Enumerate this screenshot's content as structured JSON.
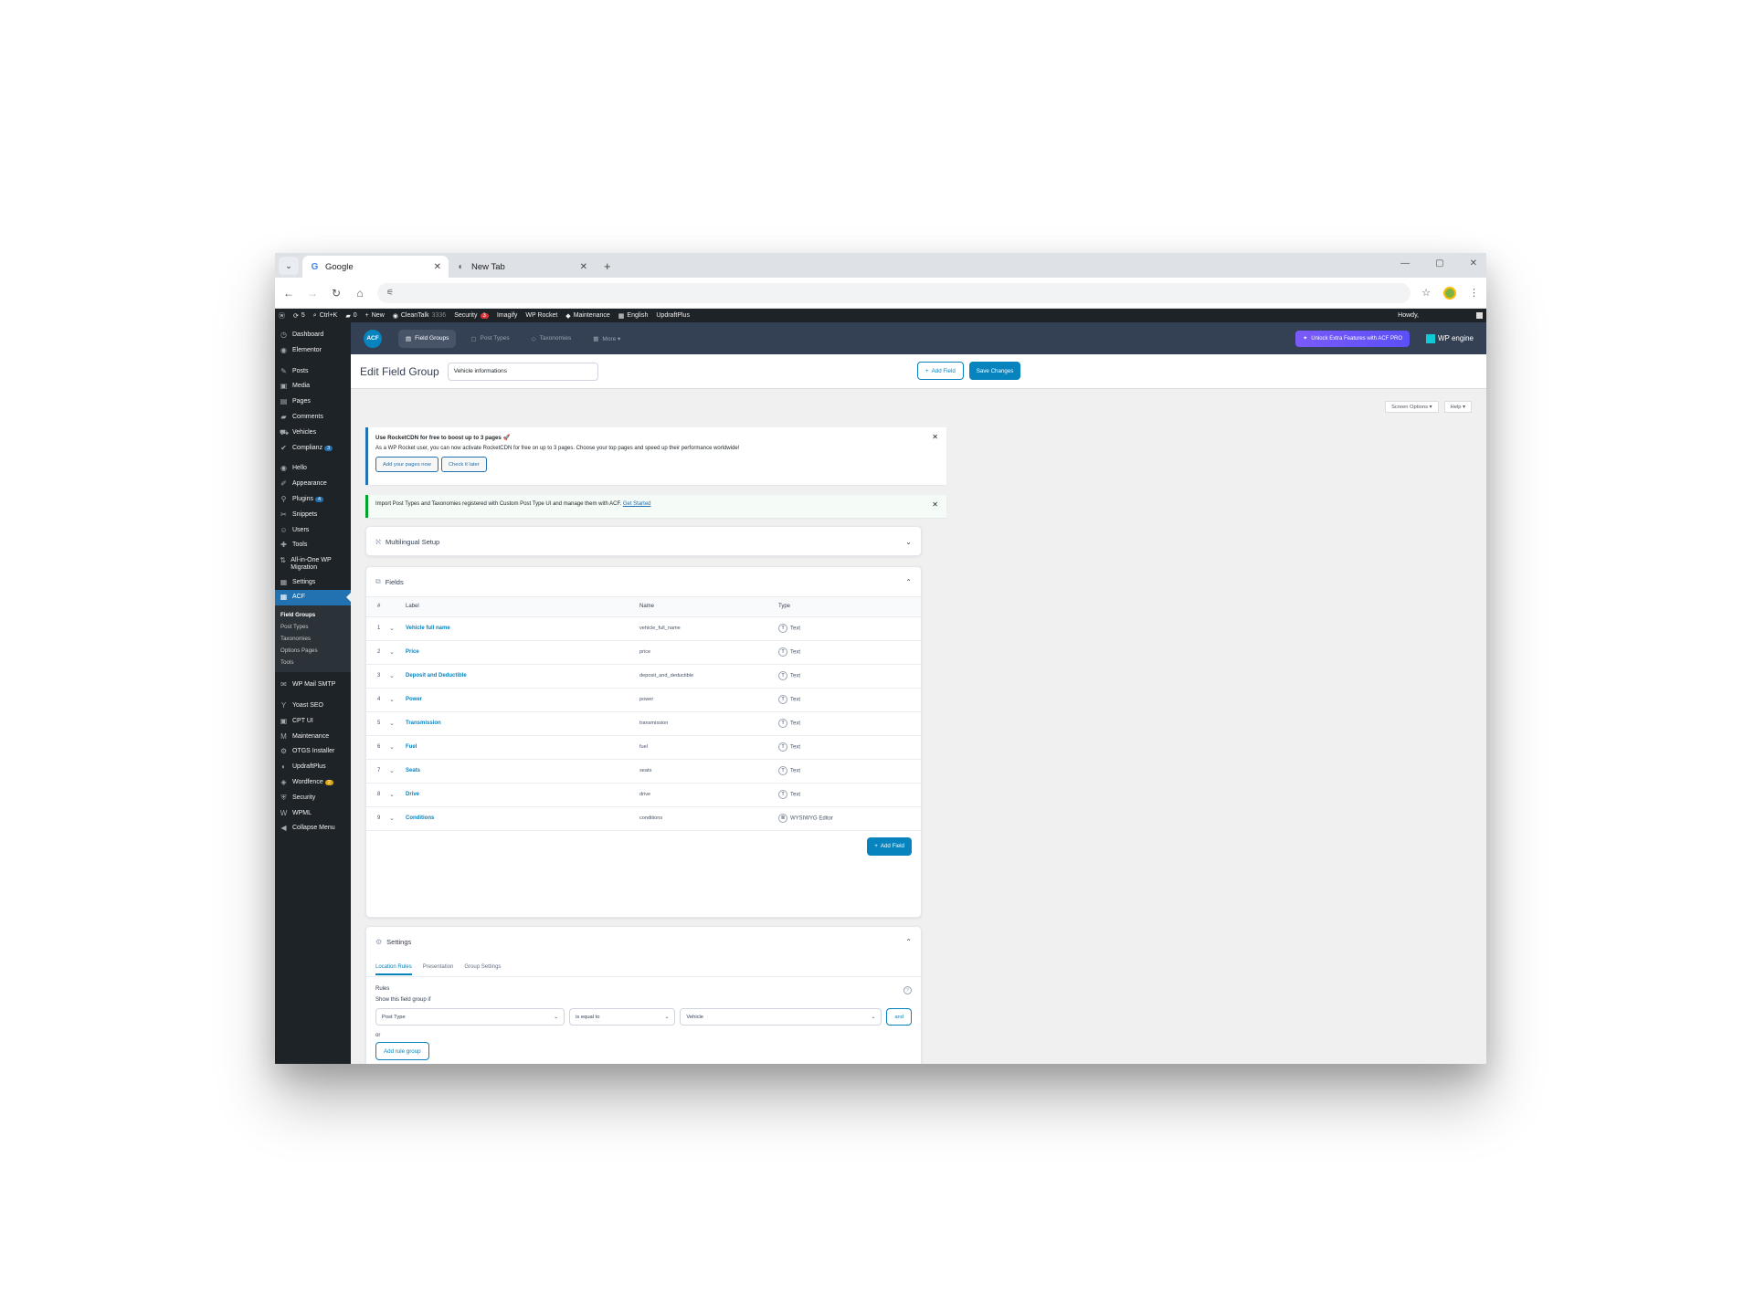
{
  "browser": {
    "tabs": [
      {
        "title": "Google",
        "favicon": "G",
        "active": true
      },
      {
        "title": "New Tab",
        "favicon": "◐",
        "active": false
      }
    ],
    "new_tab": "+",
    "window_controls": [
      "—",
      "▢",
      "✕"
    ]
  },
  "adminbar": {
    "items": [
      {
        "icon": "wp-logo-icon",
        "glyph": "ⓦ",
        "text": ""
      },
      {
        "icon": "updates-icon",
        "glyph": "⟳",
        "text": "5"
      },
      {
        "icon": "search-icon",
        "glyph": "⌕",
        "text": "Ctrl+K"
      },
      {
        "icon": "comments-icon",
        "glyph": "▰",
        "text": "0"
      },
      {
        "icon": "plus-icon",
        "glyph": "+",
        "text": "New"
      },
      {
        "icon": "cleantalk-icon",
        "glyph": "◉",
        "text": "CleanTalk"
      },
      {
        "icon": "security-icon",
        "glyph": "",
        "text": "Security",
        "badge": "3"
      },
      {
        "icon": "imagify-icon",
        "glyph": "",
        "text": "Imagify"
      },
      {
        "icon": "rocket-icon",
        "glyph": "",
        "text": "WP Rocket"
      },
      {
        "icon": "maintenance-icon",
        "glyph": "◆",
        "text": "Maintenance"
      },
      {
        "icon": "flag-icon",
        "glyph": "▦",
        "text": "English"
      },
      {
        "icon": "updraft-icon",
        "glyph": "",
        "text": "UpdraftPlus"
      }
    ],
    "cleantalk_count": "3336",
    "howdy": "Howdy,"
  },
  "sidebar": {
    "items": [
      {
        "icon": "dashboard-icon",
        "glyph": "◷",
        "label": "Dashboard"
      },
      {
        "icon": "elementor-icon",
        "glyph": "◉",
        "label": "Elementor"
      },
      {
        "sep": true
      },
      {
        "icon": "posts-icon",
        "glyph": "✎",
        "label": "Posts"
      },
      {
        "icon": "media-icon",
        "glyph": "▣",
        "label": "Media"
      },
      {
        "icon": "pages-icon",
        "glyph": "▤",
        "label": "Pages"
      },
      {
        "icon": "comments-icon",
        "glyph": "▰",
        "label": "Comments"
      },
      {
        "icon": "vehicles-icon",
        "glyph": "⛟",
        "label": "Vehicles"
      },
      {
        "icon": "complianz-icon",
        "glyph": "✔",
        "label": "Complianz",
        "badge": "3"
      },
      {
        "sep": true
      },
      {
        "icon": "hello-icon",
        "glyph": "◉",
        "label": "Hello"
      },
      {
        "icon": "appearance-icon",
        "glyph": "✐",
        "label": "Appearance"
      },
      {
        "icon": "plugins-icon",
        "glyph": "⚲",
        "label": "Plugins",
        "badge": "4"
      },
      {
        "icon": "snippets-icon",
        "glyph": "✂",
        "label": "Snippets"
      },
      {
        "icon": "users-icon",
        "glyph": "☺",
        "label": "Users"
      },
      {
        "icon": "tools-icon",
        "glyph": "✚",
        "label": "Tools"
      },
      {
        "icon": "migration-icon",
        "glyph": "⇅",
        "label": "All-in-One WP Migration"
      },
      {
        "icon": "settings-icon",
        "glyph": "▦",
        "label": "Settings"
      },
      {
        "icon": "acf-icon",
        "glyph": "▦",
        "label": "ACF",
        "current": true
      }
    ],
    "submenu": [
      {
        "label": "Field Groups",
        "current": true
      },
      {
        "label": "Post Types"
      },
      {
        "label": "Taxonomies"
      },
      {
        "label": "Options Pages"
      },
      {
        "label": "Tools"
      }
    ],
    "items_after": [
      {
        "icon": "mail-icon",
        "glyph": "✉",
        "label": "WP Mail SMTP"
      },
      {
        "sep": true
      },
      {
        "icon": "yoast-icon",
        "glyph": "Y",
        "label": "Yoast SEO"
      },
      {
        "icon": "cptui-icon",
        "glyph": "▣",
        "label": "CPT UI"
      },
      {
        "icon": "maintenance-icon",
        "glyph": "M",
        "label": "Maintenance"
      },
      {
        "icon": "otgs-icon",
        "glyph": "⚙",
        "label": "OTGS Installer"
      },
      {
        "icon": "updraft-icon",
        "glyph": "◐",
        "label": "UpdraftPlus"
      },
      {
        "icon": "wordfence-icon",
        "glyph": "◈",
        "label": "Wordfence",
        "badge": "2",
        "badge_color": "orange"
      },
      {
        "icon": "security-icon",
        "glyph": "⛨",
        "label": "Security"
      },
      {
        "icon": "wpml-icon",
        "glyph": "W",
        "label": "WPML"
      },
      {
        "icon": "collapse-icon",
        "glyph": "◀",
        "label": "Collapse Menu"
      }
    ]
  },
  "acf_header": {
    "logo": "ACF",
    "nav": [
      {
        "icon": "field-groups-icon",
        "glyph": "▤",
        "label": "Field Groups",
        "active": true
      },
      {
        "icon": "post-types-icon",
        "glyph": "▢",
        "label": "Post Types"
      },
      {
        "icon": "taxonomies-icon",
        "glyph": "◇",
        "label": "Taxonomies"
      },
      {
        "icon": "more-icon",
        "glyph": "▦",
        "label": "More ▾"
      }
    ],
    "unlock": "Unlock Extra Features with ACF PRO",
    "wpengine": "WP engine"
  },
  "editbar": {
    "title": "Edit Field Group",
    "input_value": "Vehicle informations",
    "add_field": "Add Field",
    "save": "Save Changes"
  },
  "screen_options": {
    "screen": "Screen Options ▾",
    "help": "Help ▾"
  },
  "notices": {
    "rocket_title": "Use RocketCDN for free to boost up to 3 pages 🚀",
    "rocket_text": "As a WP Rocket user, you can now activate RocketCDN for free on up to 3 pages. Choose your top pages and speed up their performance worldwide!",
    "rocket_btn1": "Add your pages now",
    "rocket_btn2": "Check it later",
    "cptui_text": "Import Post Types and Taxonomies registered with Custom Post Type UI and manage them with ACF.",
    "cptui_link": "Get Started"
  },
  "multilingual": {
    "title": "Multilingual Setup"
  },
  "fields": {
    "title": "Fields",
    "headers": {
      "num": "#",
      "label": "Label",
      "name": "Name",
      "type": "Type"
    },
    "rows": [
      {
        "num": "1",
        "label": "Vehicle full name",
        "name": "vehicle_full_name",
        "type": "Text"
      },
      {
        "num": "2",
        "label": "Price",
        "name": "price",
        "type": "Text"
      },
      {
        "num": "3",
        "label": "Deposit and Deductible",
        "name": "deposit_and_deductible",
        "type": "Text"
      },
      {
        "num": "4",
        "label": "Power",
        "name": "power",
        "type": "Text"
      },
      {
        "num": "5",
        "label": "Transmission",
        "name": "transmission",
        "type": "Text"
      },
      {
        "num": "6",
        "label": "Fuel",
        "name": "fuel",
        "type": "Text"
      },
      {
        "num": "7",
        "label": "Seats",
        "name": "seats",
        "type": "Text"
      },
      {
        "num": "8",
        "label": "Drive",
        "name": "drive",
        "type": "Text"
      },
      {
        "num": "9",
        "label": "Conditions",
        "name": "conditions",
        "type": "WYSIWYG Editor"
      }
    ],
    "add_field": "Add Field"
  },
  "settings": {
    "title": "Settings",
    "tabs": [
      "Location Rules",
      "Presentation",
      "Group Settings"
    ],
    "rules_label": "Rules",
    "show_if": "Show this field group if",
    "param": "Post Type",
    "operator": "is equal to",
    "value": "Vehicle",
    "and": "and",
    "or": "or",
    "add_rule_group": "Add rule group"
  }
}
